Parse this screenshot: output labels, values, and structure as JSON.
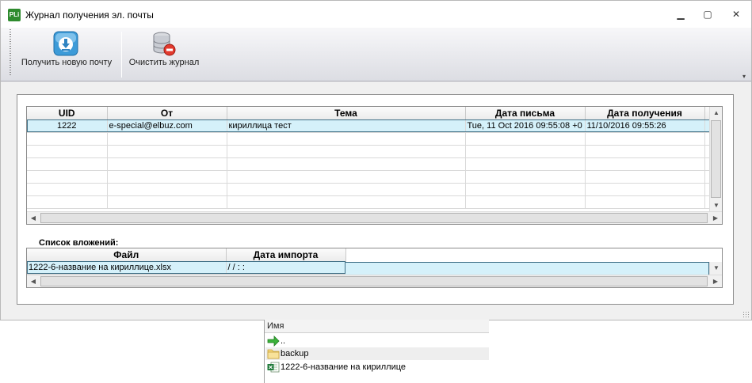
{
  "window": {
    "title": "Журнал получения эл. почты",
    "app_icon_text": "PLi",
    "controls": {
      "minimize": "▁",
      "maximize": "▢",
      "close": "✕"
    }
  },
  "toolbar": {
    "receive_label": "Получить новую почту",
    "clear_label": "Очистить журнал",
    "overflow": "▾"
  },
  "mail_grid": {
    "columns": [
      "UID",
      "От",
      "Тема",
      "Дата письма",
      "Дата получения"
    ],
    "rows": [
      {
        "uid": "1222",
        "from": "e-special@elbuz.com",
        "subject": "кириллица тест",
        "date_letter": "Tue, 11 Oct 2016 09:55:08 +0",
        "date_received": "11/10/2016 09:55:26"
      }
    ]
  },
  "attachments": {
    "section_label": "Список вложений:",
    "columns": [
      "Файл",
      "Дата импорта"
    ],
    "rows": [
      {
        "file": "1222-6-название на кириллице.xlsx",
        "import_date": "/ /     : :"
      }
    ]
  },
  "explorer": {
    "header": "Имя",
    "items": [
      {
        "label": "..",
        "icon": "up-arrow-icon"
      },
      {
        "label": "backup",
        "icon": "folder-icon"
      },
      {
        "label": "1222-6-название на кириллице",
        "icon": "excel-file-icon"
      }
    ]
  },
  "colors": {
    "selected_row": "#d5f1fa",
    "window_bg": "#f0f0f0",
    "toolbar_border": "#a9aab2"
  }
}
